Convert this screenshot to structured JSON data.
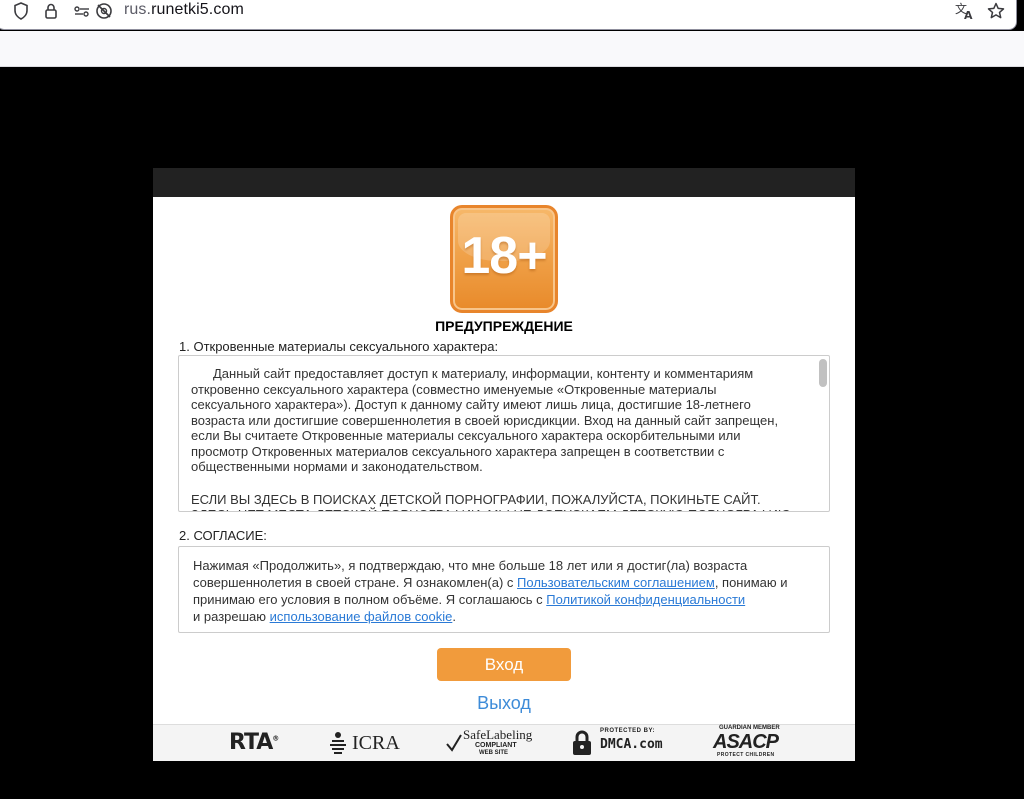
{
  "browser": {
    "url_prefix": "rus.",
    "url_host": "runetki5.com"
  },
  "modal": {
    "badge": "18+",
    "title": "ПРЕДУПРЕЖДЕНИЕ",
    "section1": {
      "title": "1. Откровенные материалы сексуального характера:",
      "paragraph": "Данный сайт предоставляет доступ к материалу, информации, контенту и комментариям откровенно сексуального характера (совместно именуемые «Откровенные материалы сексуального характера»). Доступ к данному сайту имеют лишь лица, достигшие 18-летнего возраста или достигшие совершеннолетия в своей юрисдикции. Вход на данный сайт запрещен, если Вы считаете Откровенные материалы сексуального характера оскорбительными или просмотр Откровенных материалов сексуального характера запрещен в соответствии с общественными нормами и законодательством.",
      "caps": "ЕСЛИ ВЫ ЗДЕСЬ В ПОИСКАХ ДЕТСКОЙ ПОРНОГРАФИИ, ПОЖАЛУЙСТА, ПОКИНЬТЕ САЙТ. ЗДЕСЬ НЕТ МЕСТА ДЕТСКОЙ ПОРНОГРАФИИ, МЫ НЕ ДОПУСКАЕМ ДЕТСКУЮ ПОРНОГРАФИЮ В"
    },
    "section2": {
      "title": "2. СОГЛАСИЕ:",
      "text_a": "Нажимая «Продолжить», я подтверждаю, что мне больше 18 лет или я достиг(ла) возраста совершеннолетия в своей стране. Я ознакомлен(а) с ",
      "link_terms": "Пользовательским соглашением",
      "text_b": ", понимаю и принимаю его условия в полном объёме. Я соглашаюсь с ",
      "link_privacy": "Политикой конфиденциальности",
      "text_c": " и разрешаю ",
      "link_cookies": "использование файлов cookie",
      "text_d": "."
    },
    "enter_label": "Вход",
    "exit_label": "Выход"
  },
  "footer": {
    "rta": "RTA",
    "rta_mark": "®",
    "icra": "ICRA",
    "safe_title": "SafeLabeling",
    "safe_sub1": "COMPLIANT",
    "safe_sub2": "WEB SITE",
    "dmca_top": "PROTECTED BY:",
    "dmca": "DMCA.com",
    "asacp_top": "GUARDIAN MEMBER",
    "asacp": "ASACP",
    "asacp_bottom": "PROTECT CHILDREN"
  },
  "colors": {
    "accent_orange": "#f19b3c",
    "link_blue": "#2a7ad6",
    "exit_blue": "#3d8bd8"
  }
}
